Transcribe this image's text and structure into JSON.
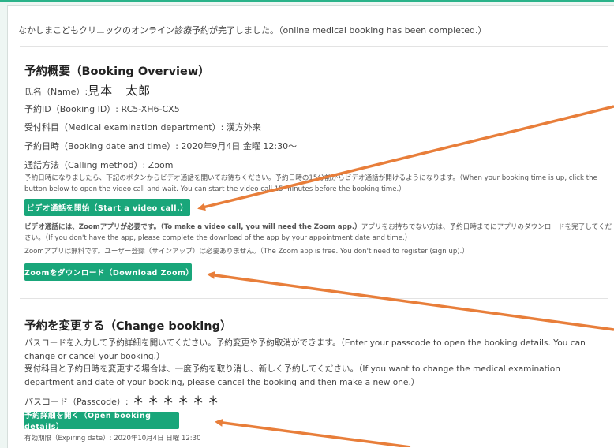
{
  "completed_message": "なかしまこどもクリニックのオンライン診療予約が完了しました。（online medical booking has been completed.）",
  "overview": {
    "heading": "予約概要（Booking Overview）",
    "name_label": "氏名（Name）:",
    "name_value": "見本　太郎",
    "booking_id": "予約ID（Booking ID）: RC5-XH6-CX5",
    "department": "受付科目（Medical examination department）: 漢方外来",
    "datetime": "予約日時（Booking date and time）: 2020年9月4日 金曜 12:30〜",
    "calling_method": "通話方法（Calling method）: Zoom",
    "video_note": "予約日時になりましたら、下記のボタンからビデオ通話を開いてお待ちください。予約日時の15分前からビデオ通話が開けるようになります。（When your booking time is up, click the button below to open the video call and wait. You can start the video call 15 minutes before the booking time.）",
    "video_button": "ビデオ通話を開始（Start a video call.）",
    "zoom_required_bold": "ビデオ通話には、Zoomアプリが必要です。（To make a video call, you will need the Zoom app.）",
    "zoom_required_rest": "アプリをお持ちでない方は、予約日時までにアプリのダウンロードを完了してください。（If you don't have the app, please complete the download of the app by your appointment date and time.）",
    "zoom_free": "Zoomアプリは無料です。ユーザー登録（サインアップ）は必要ありません。（The Zoom app is free. You don't need to register (sign up).）",
    "download_button": "Zoomをダウンロード（Download Zoom）"
  },
  "change": {
    "heading": "予約を変更する（Change booking）",
    "para1": "パスコードを入力して予約詳細を開いてください。予約変更や予約取消ができます。（Enter your passcode to open the booking details. You can change or cancel your booking.）",
    "para2": "受付科目と予約日時を変更する場合は、一度予約を取り消し、新しく予約してください。（If you want to change the medical examination department and date of your booking, please cancel the booking and then make a new one.）",
    "passcode_label": "パスコード（Passcode）:",
    "passcode_value": "＊＊＊＊＊＊",
    "open_button": "予約詳細を開く（Open booking details）",
    "expiring": "有効期限（Expiring date）: 2020年10月4日 日曜 12:30"
  },
  "colors": {
    "accent": "#19a67a",
    "arrow": "#e87e3a"
  }
}
